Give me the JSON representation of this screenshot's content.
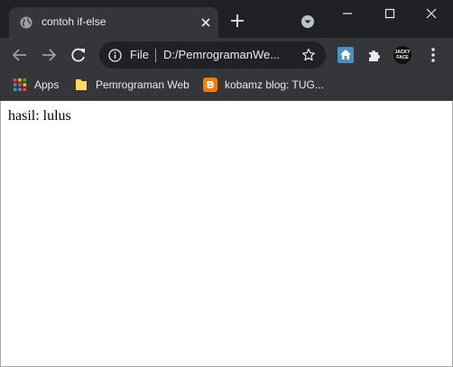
{
  "tab": {
    "title": "contoh if-else",
    "favicon": "globe-icon"
  },
  "toolbar": {
    "scheme": "File",
    "url": "D:/PemrogramanWe...",
    "avatar_text": "JACKY FACE"
  },
  "bookmarks": [
    {
      "label": "Apps",
      "icon": "apps-grid-icon"
    },
    {
      "label": "Pemrograman Web",
      "icon": "folder-icon"
    },
    {
      "label": "kobamz blog: TUG...",
      "icon": "blogger-icon"
    }
  ],
  "page": {
    "text": "hasil: lulus"
  },
  "colors": {
    "tabstrip": "#202124",
    "toolbar": "#35363a",
    "omnibox": "#202124",
    "text_light": "#e8eaed",
    "folder": "#fdd663",
    "blogger": "#f57d00"
  }
}
